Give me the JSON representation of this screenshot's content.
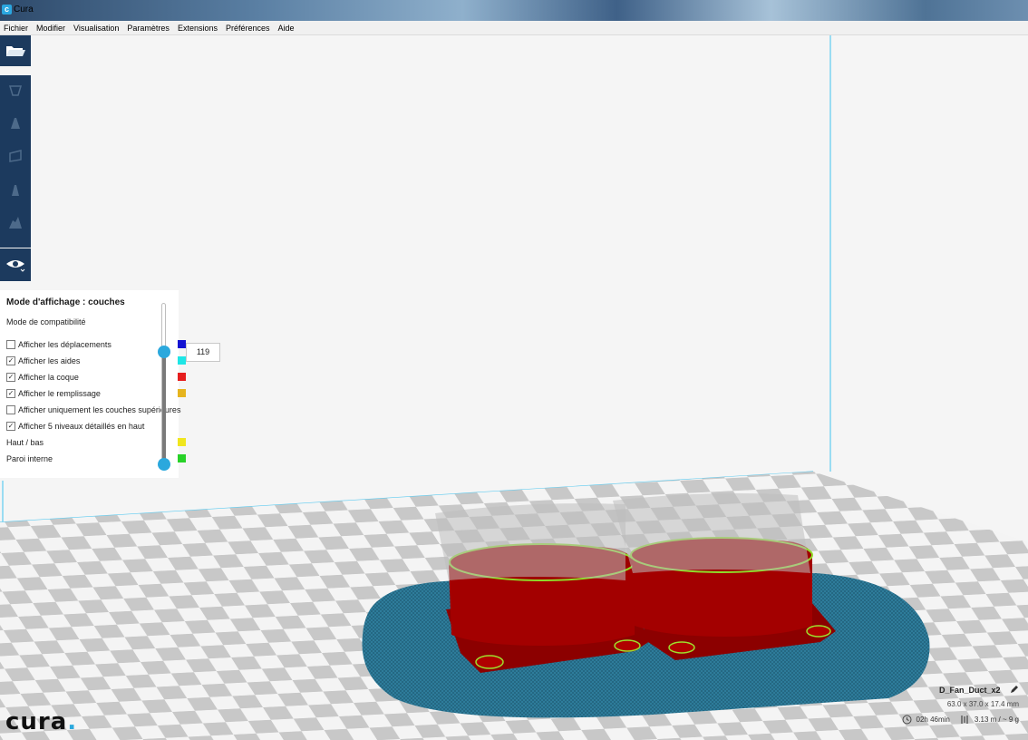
{
  "window": {
    "title": "Cura"
  },
  "menu": [
    "Fichier",
    "Modifier",
    "Visualisation",
    "Paramètres",
    "Extensions",
    "Préférences",
    "Aide"
  ],
  "layer_view": {
    "heading": "Mode d'affichage : couches",
    "compat": "Mode de compatibilité",
    "options": [
      {
        "label": "Afficher les déplacements",
        "checked": false,
        "color": "#1414d2"
      },
      {
        "label": "Afficher les aides",
        "checked": true,
        "color": "#1ee6e6"
      },
      {
        "label": "Afficher la coque",
        "checked": true,
        "color": "#e61e1e"
      },
      {
        "label": "Afficher le remplissage",
        "checked": true,
        "color": "#e6b41e"
      },
      {
        "label": "Afficher uniquement les couches supérieures",
        "checked": false
      },
      {
        "label": "Afficher 5 niveaux détaillés en haut",
        "checked": true
      }
    ],
    "legend": [
      {
        "label": "Haut / bas",
        "color": "#f0e61e"
      },
      {
        "label": "Paroi interne",
        "color": "#28d228"
      }
    ],
    "current_layer": "119"
  },
  "object": {
    "name": "D_Fan_Duct_x2",
    "dimensions": "63.0 x 37.0 x 17.4 mm",
    "print_time": "02h 46min",
    "material": "3.13 m / ~ 9 g"
  },
  "logo": {
    "text": "cura",
    "dot": "."
  },
  "icons": [
    "folder-open-icon",
    "translate-icon",
    "scale-icon",
    "rotate-icon",
    "mirror-icon",
    "per-model-settings-icon",
    "eye-icon",
    "pencil-icon",
    "clock-icon",
    "spool-icon"
  ]
}
